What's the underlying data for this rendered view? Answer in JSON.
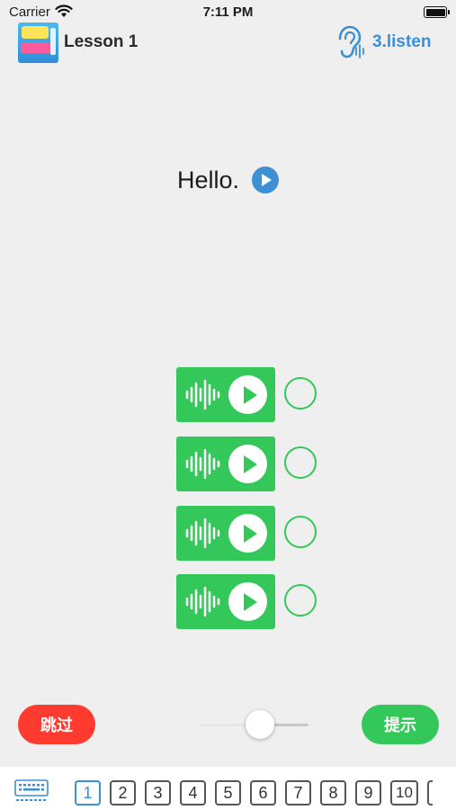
{
  "status_bar": {
    "carrier": "Carrier",
    "time": "7:11 PM"
  },
  "header": {
    "lesson_title": "Lesson 1",
    "mode_label": "3.listen",
    "mode_icon": "ear-icon",
    "accent_color": "#3a8fd6"
  },
  "prompt": {
    "text": "Hello."
  },
  "options": [
    {
      "icon": "sound-wave-icon",
      "play_icon": "play-icon",
      "selected": false
    },
    {
      "icon": "sound-wave-icon",
      "play_icon": "play-icon",
      "selected": false
    },
    {
      "icon": "sound-wave-icon",
      "play_icon": "play-icon",
      "selected": false
    },
    {
      "icon": "sound-wave-icon",
      "play_icon": "play-icon",
      "selected": false
    }
  ],
  "controls": {
    "skip_label": "跳过",
    "skip_color": "#ff3b30",
    "hint_label": "提示",
    "hint_color": "#34c759",
    "speed_slider_value": 0.55
  },
  "bottom_bar": {
    "keyboard_icon": "keyboard-icon",
    "pages": [
      "1",
      "2",
      "3",
      "4",
      "5",
      "6",
      "7",
      "8",
      "9",
      "10"
    ],
    "active_page": "1"
  }
}
